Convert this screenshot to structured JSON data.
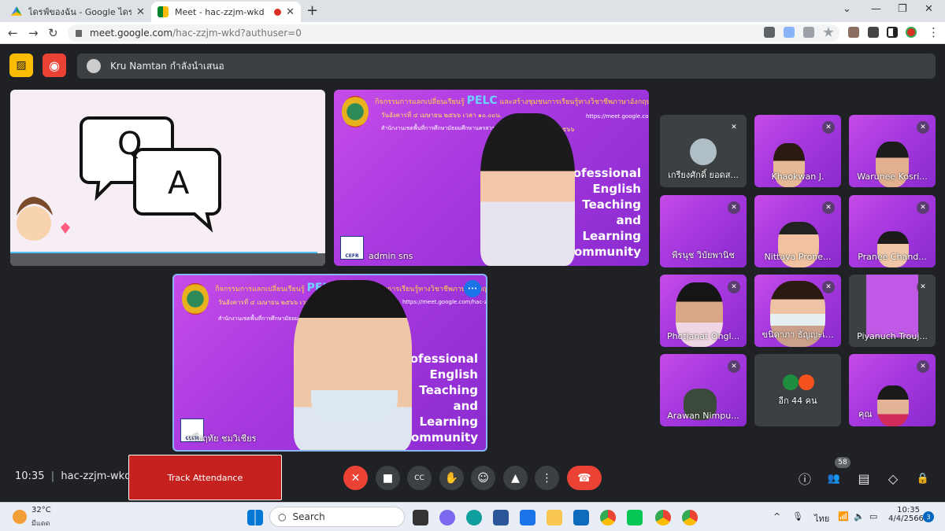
{
  "browser": {
    "tabs": [
      {
        "title": "ไดรฟ์ของฉัน - Google ไดรฟ์",
        "close": "✕"
      },
      {
        "title": "Meet - hac-zzjm-wkd",
        "close": "✕"
      }
    ],
    "new_tab": "+",
    "url_host": "meet.google.com",
    "url_path": "/hac-zzjm-wkd?authuser=0",
    "nav": {
      "back": "←",
      "forward": "→",
      "reload": "↻"
    },
    "menu": "⋮",
    "window": {
      "chevron": "⌄",
      "minimize": "—",
      "restore": "❐",
      "close": "✕"
    }
  },
  "meet": {
    "presenter_banner": "Kru Namtan กำลังนำเสนอ",
    "qa": {
      "q": "Q",
      "a": "A"
    },
    "slide": {
      "title_left": "กิจกรรมการแลกเปลี่ยนเรียนรู้",
      "pelc": "PELC",
      "title_right": "และสร้างชุมชนการเรียนรู้ทางวิชาชีพภาษาอังกฤษ",
      "date": "วันอังคารที่ ๔ เมษายน ๒๕๖๖ เวลา ๑๐.๐๐น.",
      "url": "https://meet.google.com/hac-zzjm-wkd",
      "office": "สำนักงานเขตพื้นที่การศึกษามัธยมศึกษานครสวรรค์",
      "year": "๒๕๖๖",
      "big": "Professional\nEnglish\nTeaching\nand\nLearning\nCommunity",
      "cefr": "CEFR"
    },
    "main_tiles": [
      {
        "name": "admin sns"
      },
      {
        "name": "หนึ่งฤทัย ชมวิเชียร"
      }
    ],
    "more_dots": "•••",
    "grid": [
      {
        "name": "เกรียงศักดิ์ ยอดส..."
      },
      {
        "name": "Khaokwan J."
      },
      {
        "name": "Warunee Kosri..."
      },
      {
        "name": "พีรนุช วิบัยพานิช"
      },
      {
        "name": "Nittaya Prone..."
      },
      {
        "name": "Pranee Chand..."
      },
      {
        "name": "Photjanat Ongl..."
      },
      {
        "name": "ขนิดาภา ธัญญะเ..."
      },
      {
        "name": "Piyanuch Trouj..."
      },
      {
        "name": "Arawan Nimpu..."
      },
      {
        "name": "อีก 44 คน"
      },
      {
        "name": "คุณ"
      }
    ],
    "mute_icon": "✕",
    "bottom": {
      "time": "10:35",
      "divider": "|",
      "code": "hac-zzjm-wkd",
      "track": "Track Attendance",
      "people_count": "58",
      "mic": "✕",
      "cam": "■",
      "cc": "CC",
      "hand": "✋",
      "emoji": "☺",
      "present": "▲",
      "more": "⋮",
      "end": "☎",
      "info": "ⓘ",
      "people": "👥",
      "chat": "▤",
      "activities": "◇",
      "host": "🔒"
    },
    "toolbar_icons": {
      "cast_off": "▨",
      "record": "◉"
    }
  },
  "taskbar": {
    "weather_temp": "32°C",
    "weather_desc": "มีแดด",
    "search": "Search",
    "lang": "ไทย",
    "clock_time": "10:35",
    "clock_date": "4/4/2566",
    "notif": "3",
    "tray_chevron": "^",
    "tray_mic": "🎙",
    "tray_wifi": "📶",
    "tray_vol": "🔈",
    "tray_bat": "▭"
  },
  "colors": {
    "meet_bg": "#202124",
    "end_red": "#ea4335",
    "track_red": "#c5221f",
    "slide_purple": "#b13fe4"
  }
}
